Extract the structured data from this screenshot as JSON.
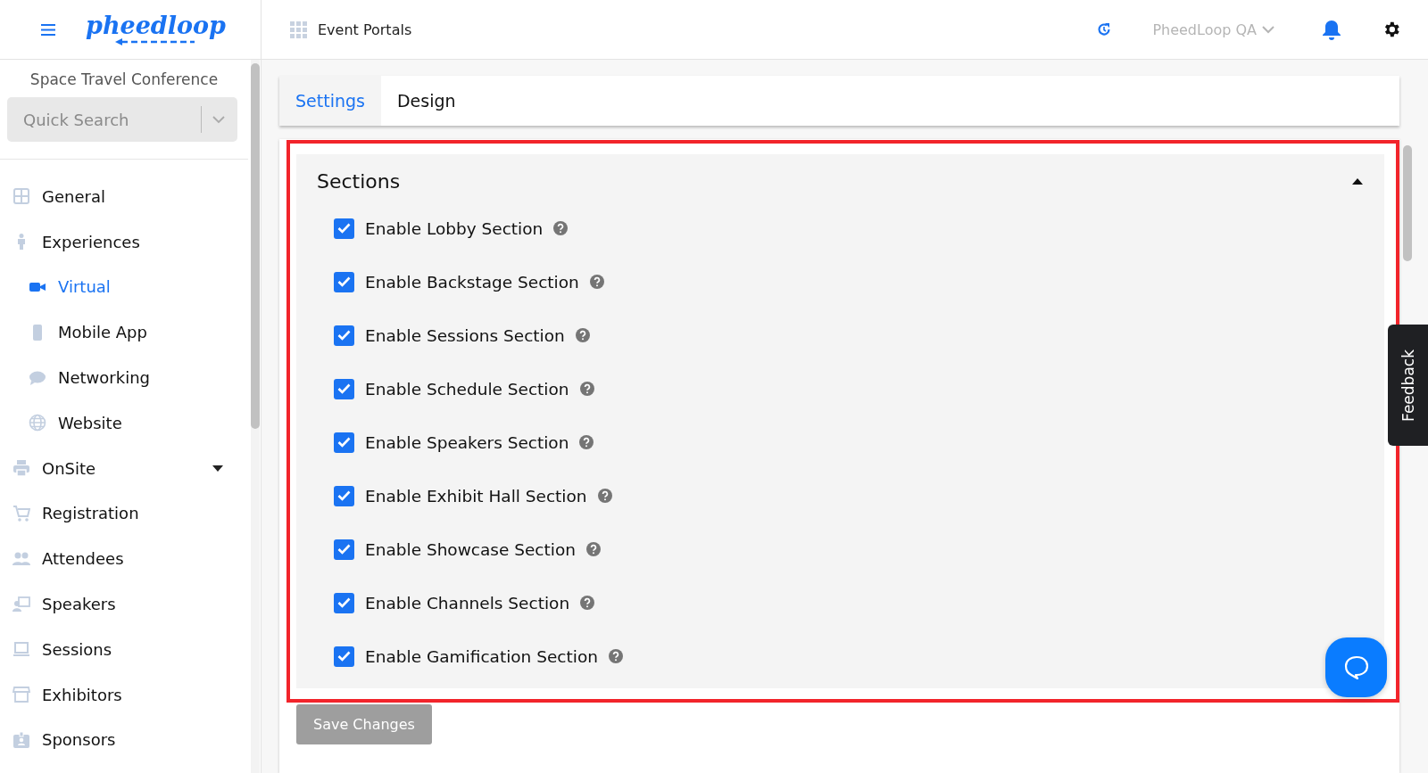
{
  "header": {
    "logo": "pheedloop",
    "breadcrumb": "Event Portals",
    "account": "PheedLoop QA"
  },
  "sidebar": {
    "event_title": "Space Travel Conference",
    "search": {
      "placeholder": "Quick Search"
    },
    "items": [
      {
        "label": "General",
        "selected": false
      },
      {
        "label": "Experiences",
        "selected": false,
        "children": [
          {
            "label": "Virtual",
            "selected": true
          },
          {
            "label": "Mobile App",
            "selected": false
          },
          {
            "label": "Networking",
            "selected": false
          },
          {
            "label": "Website",
            "selected": false
          }
        ]
      },
      {
        "label": "OnSite",
        "selected": false,
        "expanded": false
      },
      {
        "label": "Registration",
        "selected": false
      },
      {
        "label": "Attendees",
        "selected": false
      },
      {
        "label": "Speakers",
        "selected": false
      },
      {
        "label": "Sessions",
        "selected": false
      },
      {
        "label": "Exhibitors",
        "selected": false
      },
      {
        "label": "Sponsors",
        "selected": false
      }
    ]
  },
  "tabs": [
    {
      "label": "Settings",
      "selected": true
    },
    {
      "label": "Design",
      "selected": false
    }
  ],
  "sections": {
    "title": "Sections",
    "expanded": true,
    "options": [
      {
        "label": "Enable Lobby Section",
        "checked": true
      },
      {
        "label": "Enable Backstage Section",
        "checked": true
      },
      {
        "label": "Enable Sessions Section",
        "checked": true
      },
      {
        "label": "Enable Schedule Section",
        "checked": true
      },
      {
        "label": "Enable Speakers Section",
        "checked": true
      },
      {
        "label": "Enable Exhibit Hall Section",
        "checked": true
      },
      {
        "label": "Enable Showcase Section",
        "checked": true
      },
      {
        "label": "Enable Channels Section",
        "checked": true
      },
      {
        "label": "Enable Gamification Section",
        "checked": true
      }
    ]
  },
  "save_button": "Save Changes",
  "feedback_tab": "Feedback"
}
